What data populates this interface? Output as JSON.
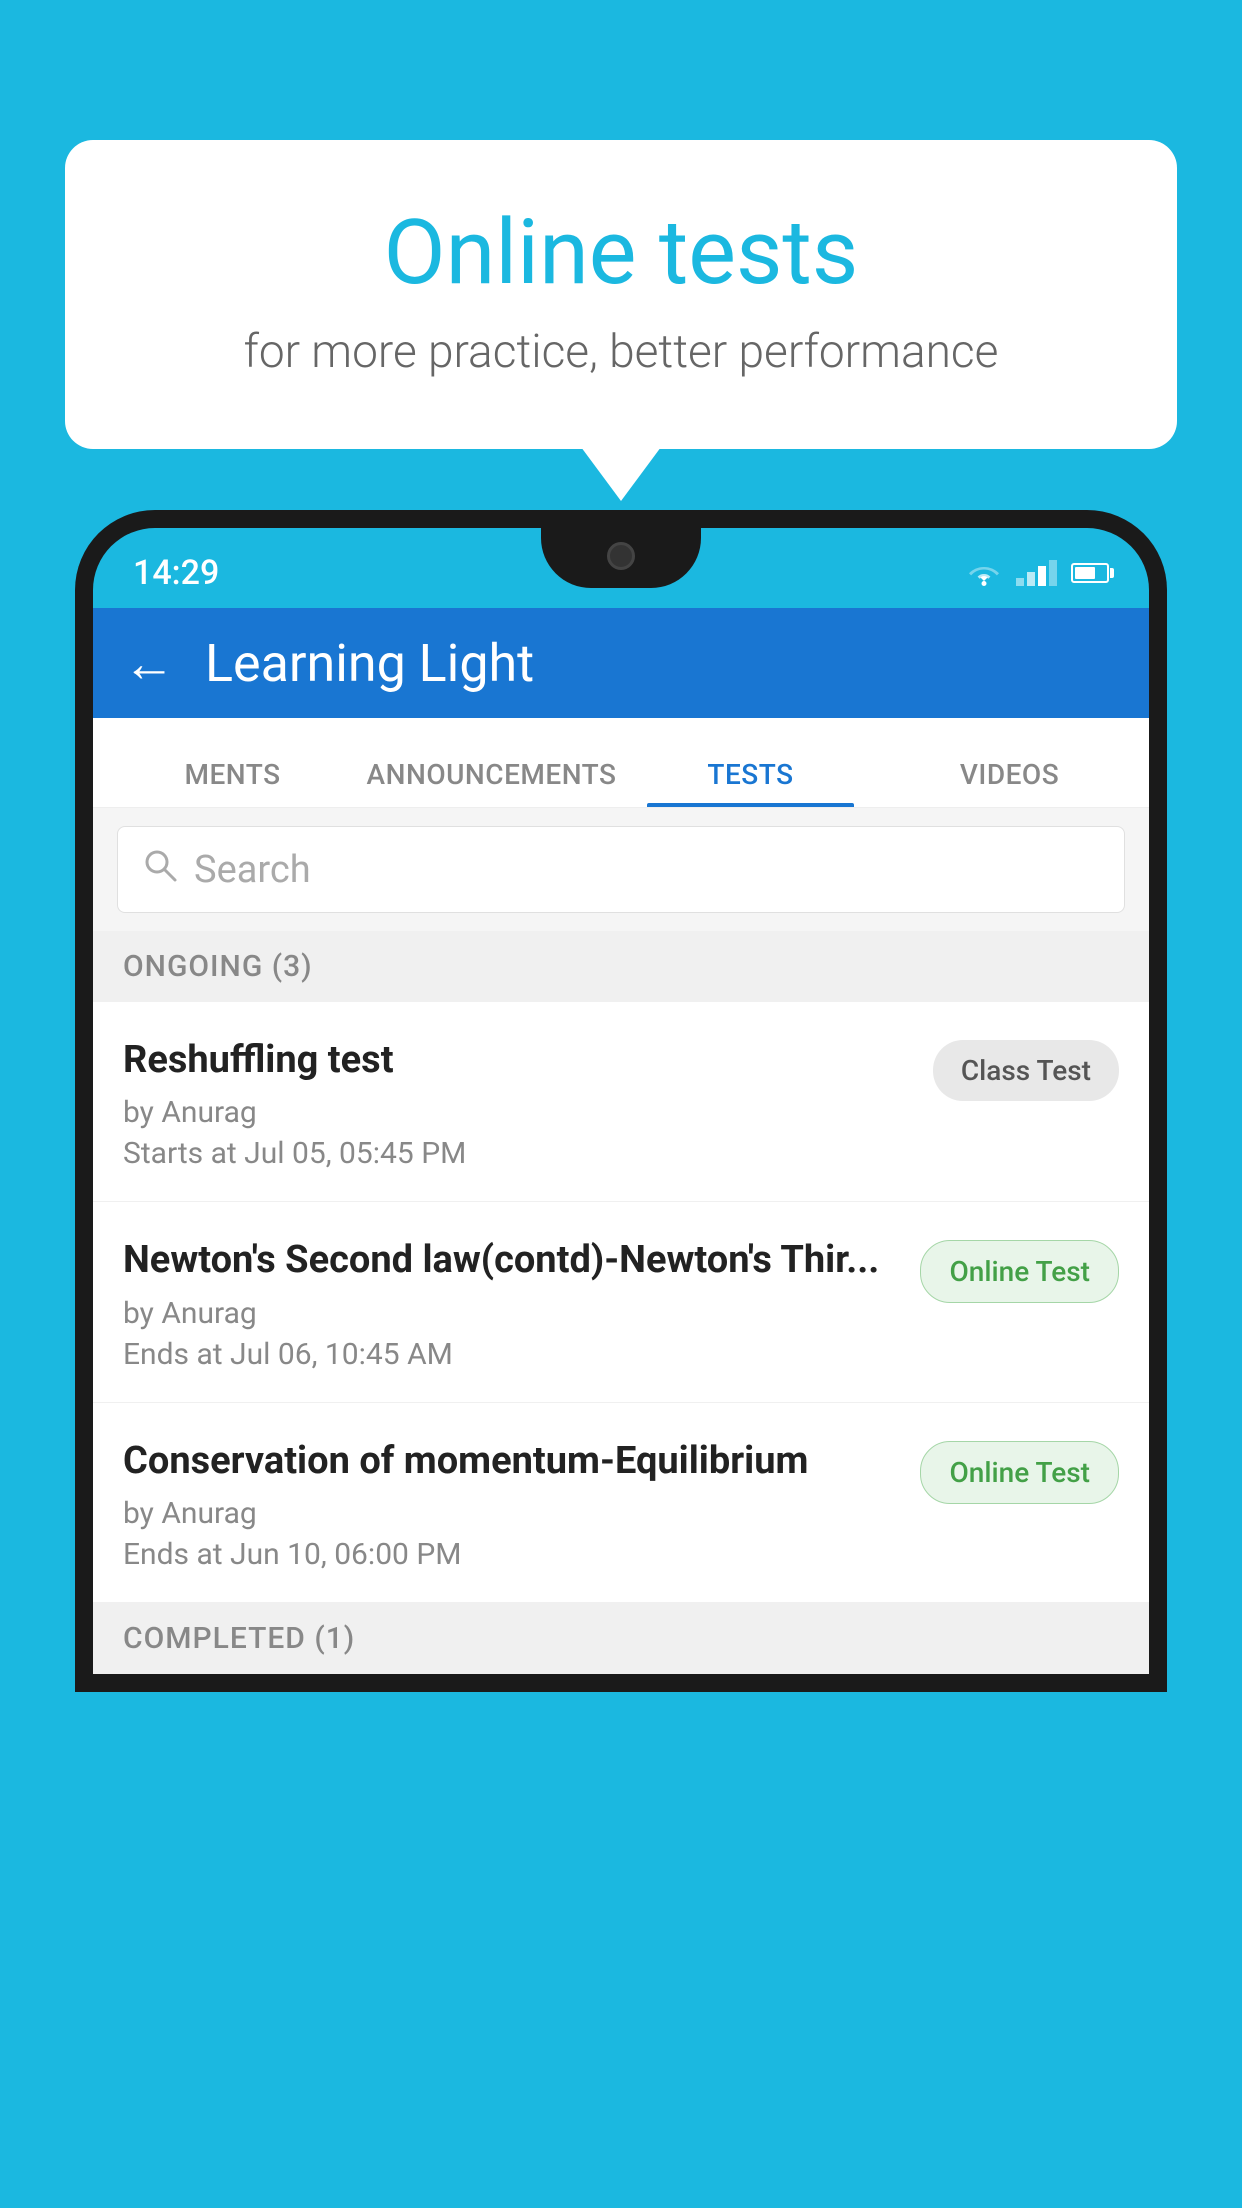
{
  "background": "#1bb8e0",
  "bubble": {
    "title": "Online tests",
    "subtitle": "for more practice, better performance"
  },
  "status_bar": {
    "time": "14:29",
    "wifi": "▼",
    "battery_level": 65
  },
  "app_bar": {
    "title": "Learning Light",
    "back_label": "←"
  },
  "tabs": [
    {
      "label": "MENTS",
      "active": false
    },
    {
      "label": "ANNOUNCEMENTS",
      "active": false
    },
    {
      "label": "TESTS",
      "active": true
    },
    {
      "label": "VIDEOS",
      "active": false
    }
  ],
  "search": {
    "placeholder": "Search"
  },
  "ongoing_section": {
    "label": "ONGOING (3)"
  },
  "tests": [
    {
      "name": "Reshuffling test",
      "by": "by Anurag",
      "date": "Starts at  Jul 05, 05:45 PM",
      "badge": "Class Test",
      "badge_type": "class"
    },
    {
      "name": "Newton's Second law(contd)-Newton's Thir...",
      "by": "by Anurag",
      "date": "Ends at  Jul 06, 10:45 AM",
      "badge": "Online Test",
      "badge_type": "online"
    },
    {
      "name": "Conservation of momentum-Equilibrium",
      "by": "by Anurag",
      "date": "Ends at  Jun 10, 06:00 PM",
      "badge": "Online Test",
      "badge_type": "online"
    }
  ],
  "completed_section": {
    "label": "COMPLETED (1)"
  }
}
